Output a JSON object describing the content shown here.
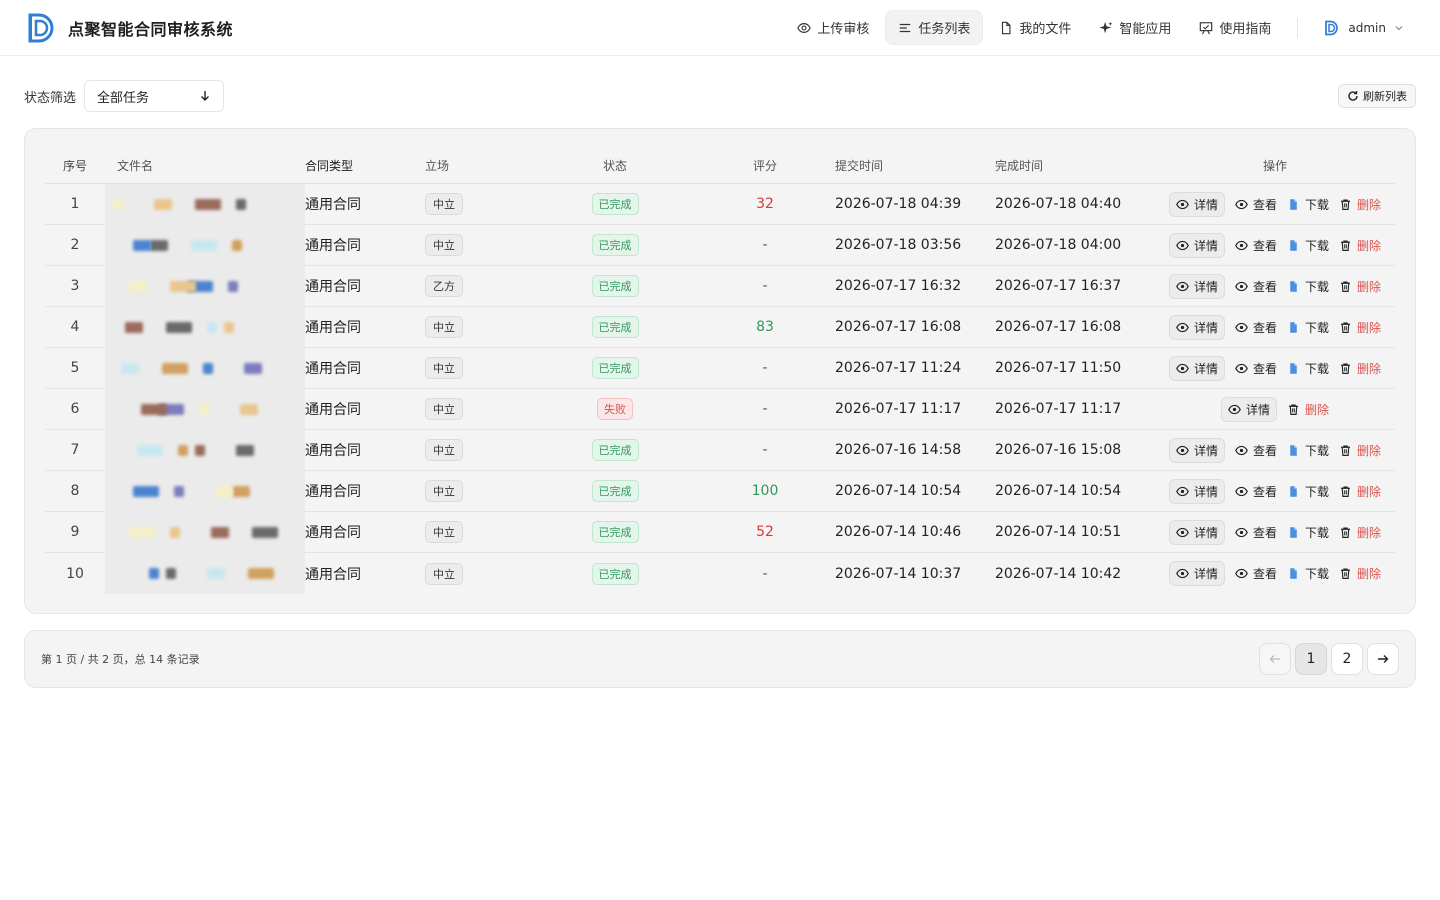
{
  "brand": {
    "title": "点聚智能合同审核系统",
    "logo_icon": "brand-d-logo",
    "accent": "#2f7fd6"
  },
  "nav": [
    {
      "label": "上传审核",
      "icon": "eye-icon",
      "active": false
    },
    {
      "label": "任务列表",
      "icon": "list-icon",
      "active": true
    },
    {
      "label": "我的文件",
      "icon": "file-icon",
      "active": false
    },
    {
      "label": "智能应用",
      "icon": "sparkle-icon",
      "active": false
    },
    {
      "label": "使用指南",
      "icon": "guide-icon",
      "active": false
    }
  ],
  "user": {
    "name": "admin"
  },
  "filter": {
    "label": "状态筛选",
    "value": "全部任务"
  },
  "refresh_label": "刷新列表",
  "table": {
    "headers": {
      "no": "序号",
      "file": "文件名",
      "type": "合同类型",
      "position": "立场",
      "status": "状态",
      "score": "评分",
      "submit": "提交时间",
      "done": "完成时间",
      "ops": "操作"
    },
    "rows": [
      {
        "no": "1",
        "type": "通用合同",
        "position": "中立",
        "status": "已完成",
        "status_kind": "ok",
        "score": "32",
        "score_kind": "red",
        "submit": "2026-07-18 04:39",
        "done": "2026-07-18 04:40",
        "ops": "full"
      },
      {
        "no": "2",
        "type": "通用合同",
        "position": "中立",
        "status": "已完成",
        "status_kind": "ok",
        "score": "-",
        "score_kind": "none",
        "submit": "2026-07-18 03:56",
        "done": "2026-07-18 04:00",
        "ops": "full"
      },
      {
        "no": "3",
        "type": "通用合同",
        "position": "乙方",
        "status": "已完成",
        "status_kind": "ok",
        "score": "-",
        "score_kind": "none",
        "submit": "2026-07-17 16:32",
        "done": "2026-07-17 16:37",
        "ops": "full"
      },
      {
        "no": "4",
        "type": "通用合同",
        "position": "中立",
        "status": "已完成",
        "status_kind": "ok",
        "score": "83",
        "score_kind": "green",
        "submit": "2026-07-17 16:08",
        "done": "2026-07-17 16:08",
        "ops": "full"
      },
      {
        "no": "5",
        "type": "通用合同",
        "position": "中立",
        "status": "已完成",
        "status_kind": "ok",
        "score": "-",
        "score_kind": "none",
        "submit": "2026-07-17 11:24",
        "done": "2026-07-17 11:50",
        "ops": "full"
      },
      {
        "no": "6",
        "type": "通用合同",
        "position": "中立",
        "status": "失败",
        "status_kind": "fail",
        "score": "-",
        "score_kind": "none",
        "submit": "2026-07-17 11:17",
        "done": "2026-07-17 11:17",
        "ops": "short"
      },
      {
        "no": "7",
        "type": "通用合同",
        "position": "中立",
        "status": "已完成",
        "status_kind": "ok",
        "score": "-",
        "score_kind": "none",
        "submit": "2026-07-16 14:58",
        "done": "2026-07-16 15:08",
        "ops": "full"
      },
      {
        "no": "8",
        "type": "通用合同",
        "position": "中立",
        "status": "已完成",
        "status_kind": "ok",
        "score": "100",
        "score_kind": "green",
        "submit": "2026-07-14 10:54",
        "done": "2026-07-14 10:54",
        "ops": "full"
      },
      {
        "no": "9",
        "type": "通用合同",
        "position": "中立",
        "status": "已完成",
        "status_kind": "ok",
        "score": "52",
        "score_kind": "red",
        "submit": "2026-07-14 10:46",
        "done": "2026-07-14 10:51",
        "ops": "full"
      },
      {
        "no": "10",
        "type": "通用合同",
        "position": "中立",
        "status": "已完成",
        "status_kind": "ok",
        "score": "-",
        "score_kind": "none",
        "submit": "2026-07-14 10:37",
        "done": "2026-07-14 10:42",
        "ops": "full"
      }
    ],
    "op_labels": {
      "detail": "详情",
      "view": "查看",
      "download": "下载",
      "delete": "删除"
    }
  },
  "pagination": {
    "info": "第 1 页 / 共 2 页，总 14 条记录",
    "pages": [
      "1",
      "2"
    ],
    "current": "1"
  }
}
